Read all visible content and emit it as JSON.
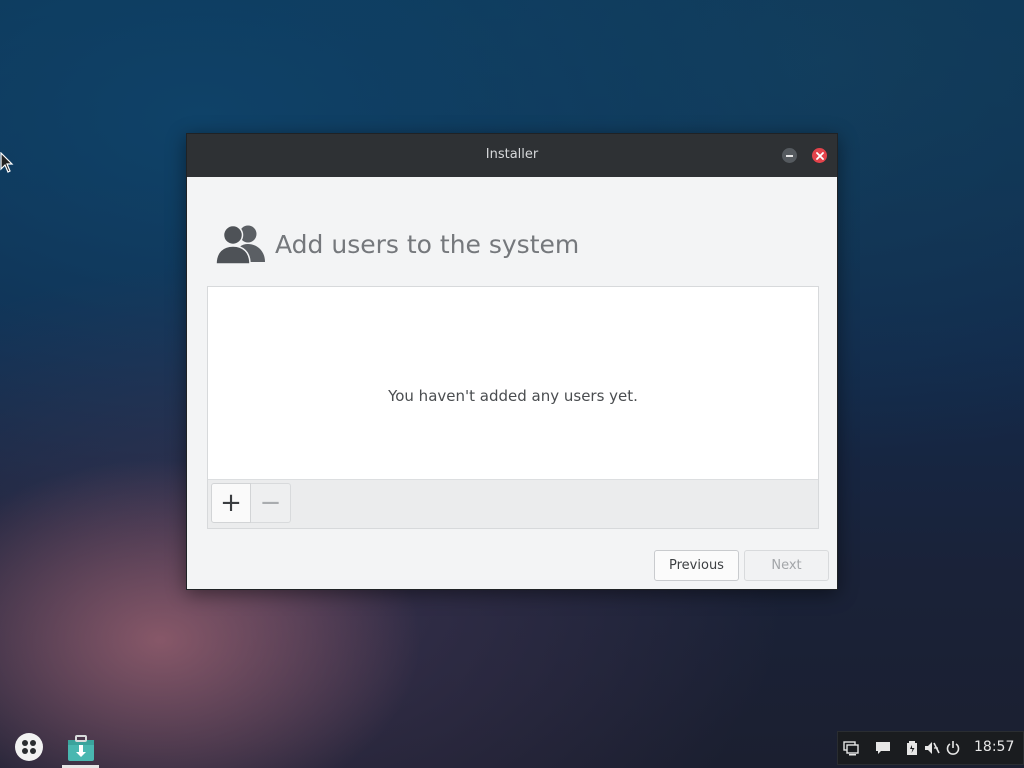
{
  "window": {
    "title": "Installer"
  },
  "page": {
    "heading": "Add users to the system",
    "empty_message": "You haven't added any users yet."
  },
  "list_toolbar": {
    "add_label": "+",
    "remove_label": "−"
  },
  "navigation": {
    "previous_label": "Previous",
    "next_label": "Next"
  },
  "taskbar": {
    "clock": "18:57",
    "icons": [
      "app-menu-icon",
      "installer-app-icon",
      "display-icon",
      "notifications-icon",
      "battery-icon",
      "volume-muted-icon",
      "power-icon"
    ]
  },
  "colors": {
    "titlebar": "#2e3134",
    "close_button": "#e4434b",
    "window_bg": "#f3f4f5"
  }
}
